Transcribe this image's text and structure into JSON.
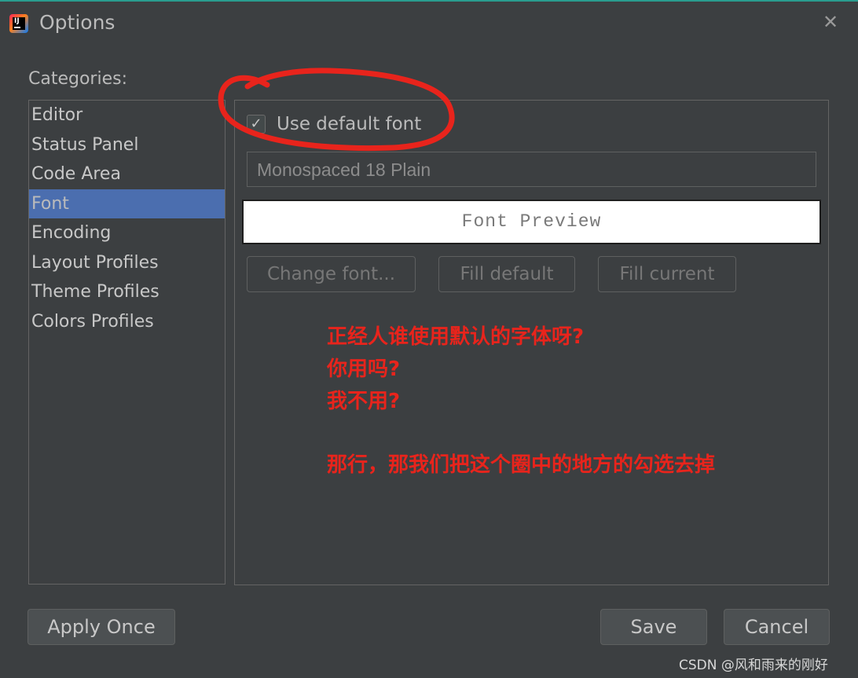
{
  "window": {
    "title": "Options",
    "app_icon_text": "IJ",
    "close_glyph": "✕"
  },
  "categories": {
    "label": "Categories:",
    "items": [
      "Editor",
      "Status Panel",
      "Code Area",
      "Font",
      "Encoding",
      "Layout Profiles",
      "Theme Profiles",
      "Colors Profiles"
    ],
    "selected": "Font"
  },
  "font_panel": {
    "use_default_font_label": "Use default font",
    "use_default_font_checked": true,
    "checkmark_glyph": "✓",
    "font_field_value": "Monospaced 18 Plain",
    "preview_text": "Font Preview",
    "change_font_label": "Change font...",
    "fill_default_label": "Fill default",
    "fill_current_label": "Fill current"
  },
  "annotation": {
    "line1": "正经人谁使用默认的字体呀?",
    "line2": "你用吗?",
    "line3": "我不用?",
    "line4": "那行，那我们把这个圈中的地方的勾选去掉",
    "color": "#e8241c"
  },
  "footer": {
    "apply_once_label": "Apply Once",
    "save_label": "Save",
    "cancel_label": "Cancel"
  },
  "watermark": "CSDN @风和雨来的刚好",
  "colors": {
    "background": "#3c3f41",
    "selection": "#4b6eaf",
    "annotation_red": "#e8241c"
  }
}
